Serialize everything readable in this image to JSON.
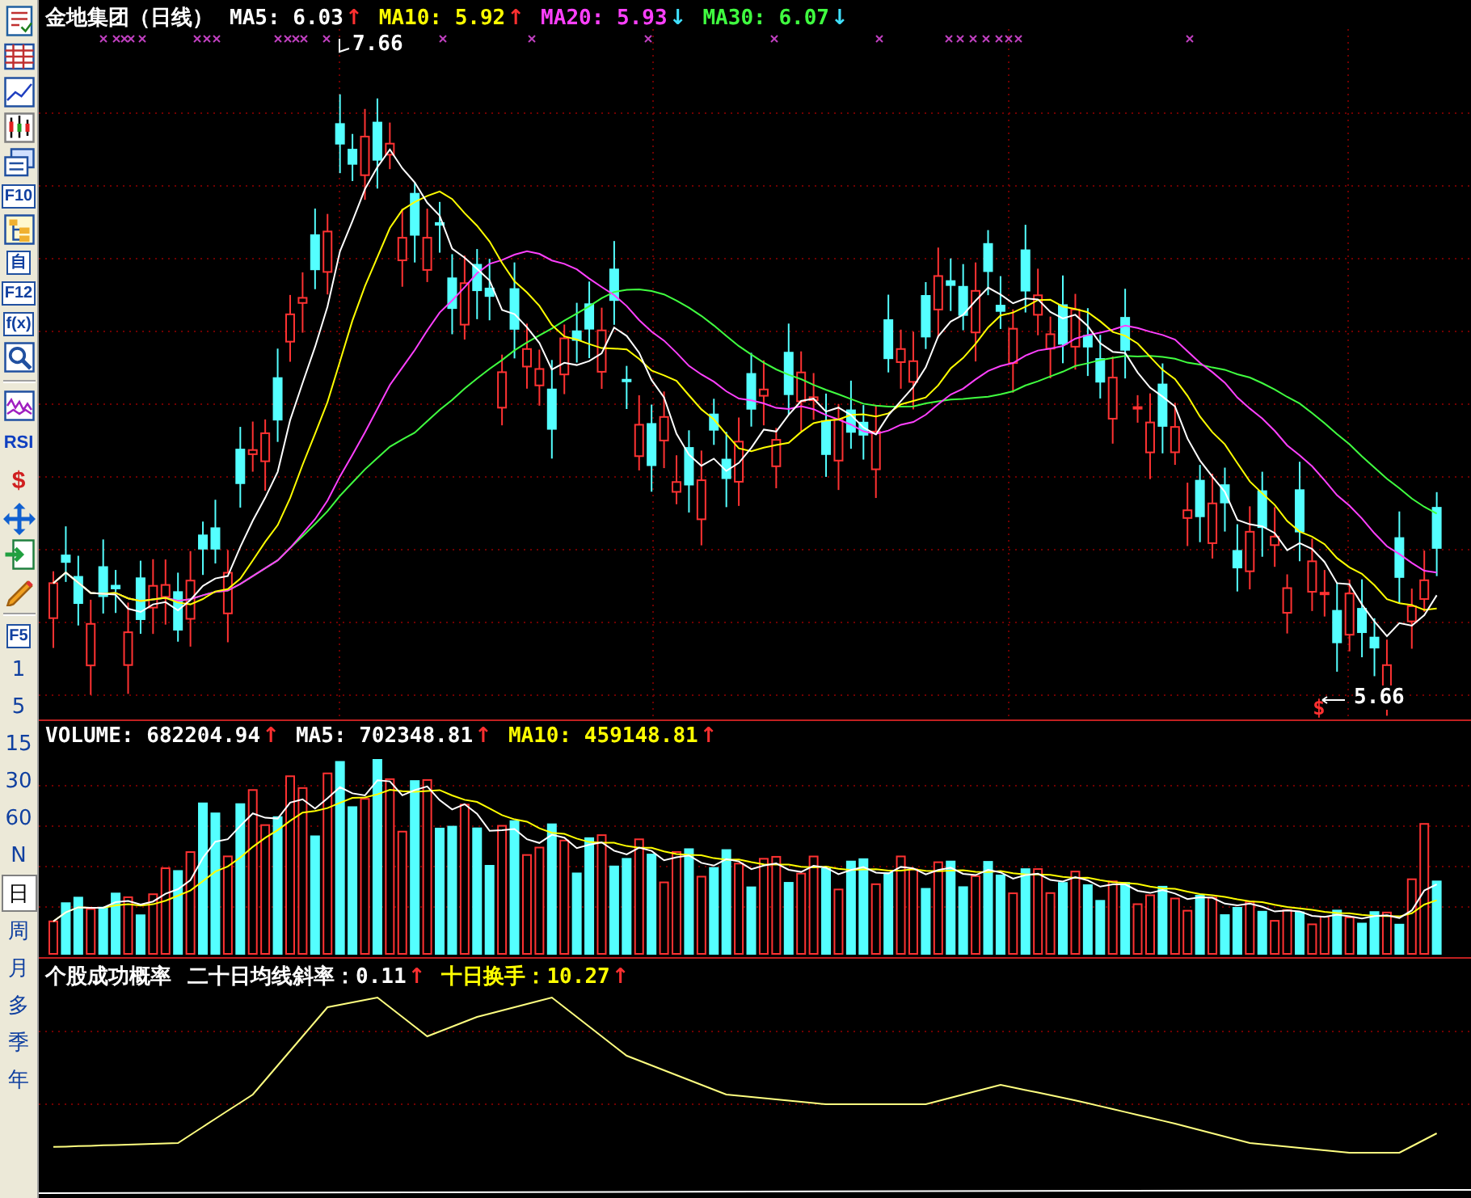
{
  "toolbar": {
    "keys": [
      {
        "label": "F10",
        "kind": "boxed"
      },
      {
        "label": "自",
        "kind": "boxed"
      },
      {
        "label": "F12",
        "kind": "boxed"
      },
      {
        "label": "f(x)",
        "kind": "boxed"
      },
      {
        "label": "RSI",
        "kind": "plain"
      },
      {
        "label": "$",
        "kind": "plain"
      },
      {
        "label": "F5",
        "kind": "boxed"
      }
    ],
    "periods": [
      {
        "label": "1",
        "selected": false
      },
      {
        "label": "5",
        "selected": false
      },
      {
        "label": "15",
        "selected": false
      },
      {
        "label": "30",
        "selected": false
      },
      {
        "label": "60",
        "selected": false
      },
      {
        "label": "N",
        "selected": false
      },
      {
        "label": "日",
        "selected": true
      },
      {
        "label": "周",
        "selected": false
      },
      {
        "label": "月",
        "selected": false
      },
      {
        "label": "多",
        "selected": false
      },
      {
        "label": "季",
        "selected": false
      },
      {
        "label": "年",
        "selected": false
      }
    ]
  },
  "main_panel": {
    "title": "金地集团（日线）",
    "indicators": [
      {
        "text": "MA5: 6.03",
        "arrow": {
          "glyph": "↑",
          "color": "#ff3030"
        },
        "color": "#ffffff"
      },
      {
        "text": "MA10: 5.92",
        "arrow": {
          "glyph": "↑",
          "color": "#ff3030"
        },
        "color": "#ffff00"
      },
      {
        "text": "MA20: 5.93",
        "arrow": {
          "glyph": "↓",
          "color": "#40e0ff"
        },
        "color": "#ff40ff"
      },
      {
        "text": "MA30: 6.07",
        "arrow": {
          "glyph": "↓",
          "color": "#40e0ff"
        },
        "color": "#40ff40"
      }
    ],
    "high_label": "7.66",
    "low_label": "5.66",
    "signal_mark": "$"
  },
  "volume_panel": {
    "indicators": [
      {
        "text": "VOLUME: 682204.94",
        "arrow": {
          "glyph": "↑",
          "color": "#ff3030"
        },
        "color": "#ffffff"
      },
      {
        "text": "MA5: 702348.81",
        "arrow": {
          "glyph": "↑",
          "color": "#ff3030"
        },
        "color": "#ffffff"
      },
      {
        "text": "MA10: 459148.81",
        "arrow": {
          "glyph": "↑",
          "color": "#ff3030"
        },
        "color": "#ffff00"
      }
    ]
  },
  "indicator_panel": {
    "title": "个股成功概率",
    "indicators": [
      {
        "text": "二十日均线斜率：0.11",
        "arrow": {
          "glyph": "↑",
          "color": "#ff3030"
        },
        "color": "#ffffff"
      },
      {
        "text": "十日换手：10.27",
        "arrow": {
          "glyph": "↑",
          "color": "#ff3030"
        },
        "color": "#ffff00"
      }
    ]
  }
}
